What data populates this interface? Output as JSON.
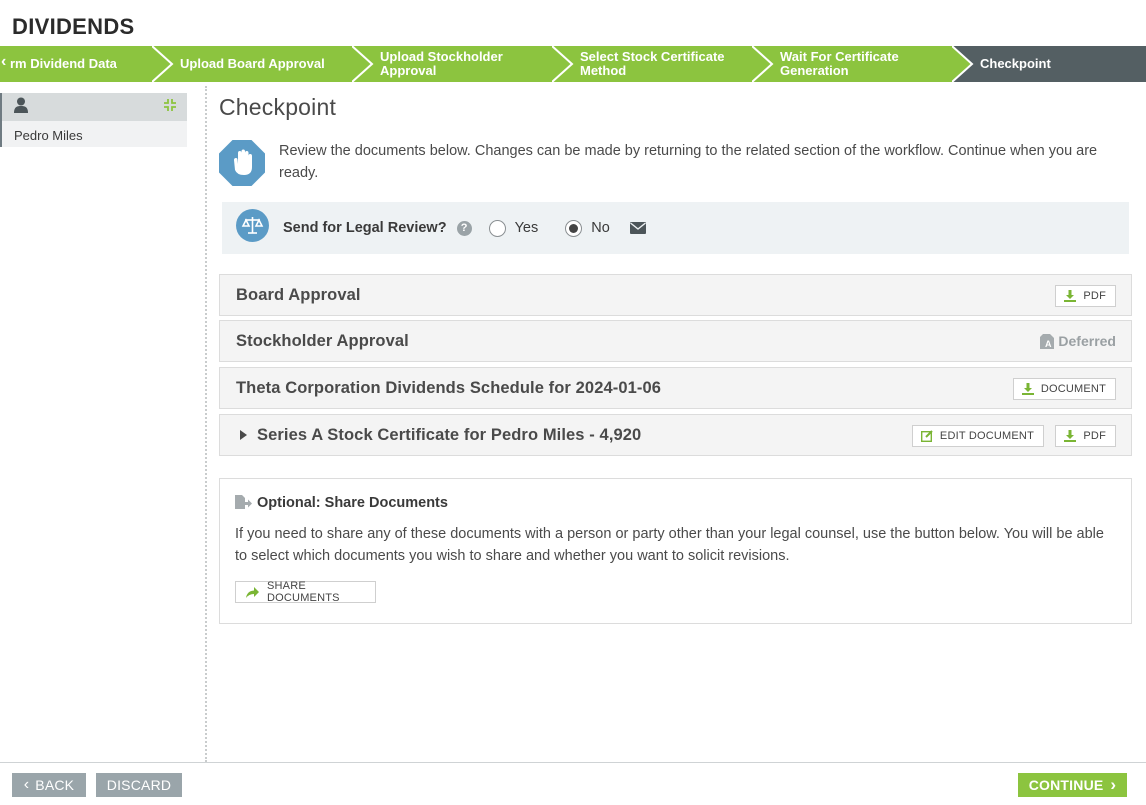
{
  "app": {
    "title": "DIVIDENDS"
  },
  "steps": [
    {
      "label": "rm Dividend Data",
      "state": "done"
    },
    {
      "label": "Upload Board Approval",
      "state": "done"
    },
    {
      "label": "Upload Stockholder Approval",
      "state": "done"
    },
    {
      "label": "Select Stock Certificate Method",
      "state": "done"
    },
    {
      "label": "Wait For Certificate Generation",
      "state": "done"
    },
    {
      "label": "Checkpoint",
      "state": "current"
    }
  ],
  "sidebar": {
    "person_name": "Pedro Miles"
  },
  "main": {
    "title": "Checkpoint",
    "intro": "Review the documents below. Changes can be made by returning to the related section of the workflow. Continue when you are ready.",
    "legal_review": {
      "label": "Send for Legal Review?",
      "help": "?",
      "yes_label": "Yes",
      "no_label": "No",
      "selected": "No"
    },
    "documents": [
      {
        "name": "Board Approval",
        "actions": [
          "PDF"
        ]
      },
      {
        "name": "Stockholder Approval",
        "status": "Deferred"
      },
      {
        "name": "Theta Corporation Dividends Schedule for 2024-01-06",
        "actions": [
          "DOCUMENT"
        ]
      },
      {
        "name": "Series A Stock Certificate for Pedro Miles - 4,920",
        "actions": [
          "EDIT DOCUMENT",
          "PDF"
        ]
      }
    ],
    "share": {
      "heading": "Optional: Share Documents",
      "text": "If you need to share any of these documents with a person or party other than your legal counsel, use the button below. You will be able to select which documents you wish to share and whether you want to solicit revisions.",
      "button": "SHARE DOCUMENTS"
    }
  },
  "footer": {
    "back": "BACK",
    "discard": "DISCARD",
    "continue": "CONTINUE"
  },
  "colors": {
    "step_done": "#8cc43f",
    "step_current": "#545f63",
    "accent_blue": "#5b9bc6",
    "icon_green": "#7ab534"
  }
}
